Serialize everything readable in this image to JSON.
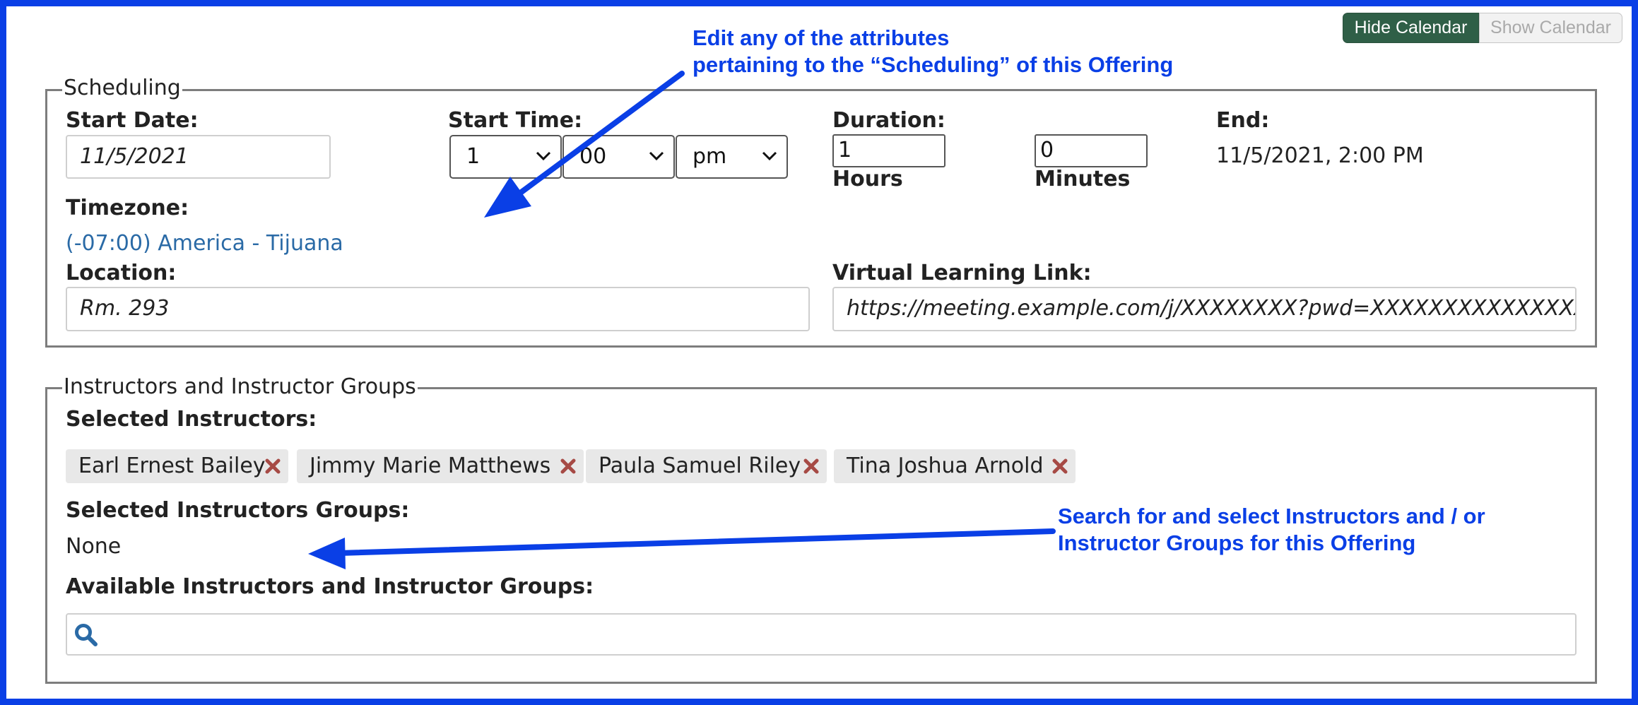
{
  "calendar": {
    "hide_label": "Hide Calendar",
    "show_label": "Show Calendar"
  },
  "annotations": {
    "scheduling_line1": "Edit any of the attributes",
    "scheduling_line2": "pertaining to the “Scheduling” of this Offering",
    "instructors_line1": "Search for and select Instructors and / or",
    "instructors_line2": "Instructor Groups for this Offering"
  },
  "scheduling": {
    "legend": "Scheduling",
    "start_date_label": "Start Date:",
    "start_date_value": "11/5/2021",
    "start_time_label": "Start Time:",
    "start_hour": "1",
    "start_minute": "00",
    "start_ampm": "pm",
    "duration_label": "Duration:",
    "duration_hours": "1",
    "hours_label": "Hours",
    "duration_minutes": "0",
    "minutes_label": "Minutes",
    "end_label": "End:",
    "end_value": "11/5/2021, 2:00 PM",
    "timezone_label": "Timezone:",
    "timezone_value": "(-07:00) America - Tijuana",
    "location_label": "Location:",
    "location_value": "Rm. 293",
    "virtual_link_label": "Virtual Learning Link:",
    "virtual_link_value": "https://meeting.example.com/j/XXXXXXXX?pwd=XXXXXXXXXXXXXXXX"
  },
  "instructors": {
    "legend": "Instructors and Instructor Groups",
    "selected_instructors_label": "Selected Instructors:",
    "selected": [
      "Earl Ernest Bailey",
      "Jimmy Marie Matthews",
      "Paula Samuel Riley",
      "Tina Joshua Arnold"
    ],
    "selected_groups_label": "Selected Instructors Groups:",
    "selected_groups_value": "None",
    "available_label": "Available Instructors and Instructor Groups:",
    "search_placeholder": ""
  },
  "colors": {
    "annotation": "#0a3fe6",
    "hide_button": "#2f5f47",
    "remove_x": "#a64a45",
    "link": "#2a6aa6"
  }
}
